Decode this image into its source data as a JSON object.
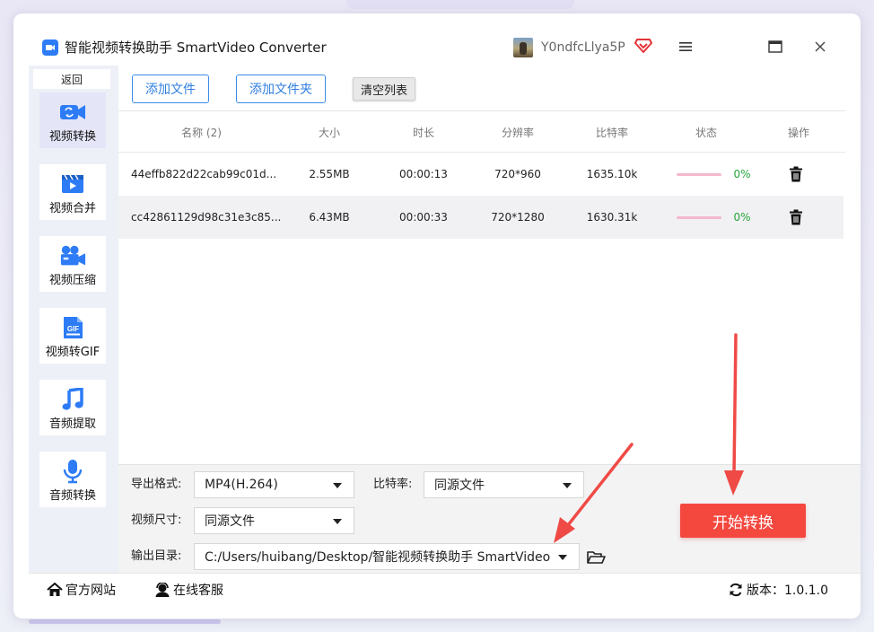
{
  "window": {
    "title": "智能视频转换助手 SmartVideo Converter",
    "username": "Y0ndfcLlya5P"
  },
  "sidebar": {
    "back_label": "返回",
    "items": [
      {
        "label": "视频转换",
        "icon": "video-convert-icon",
        "active": true
      },
      {
        "label": "视频合并",
        "icon": "video-merge-icon",
        "active": false
      },
      {
        "label": "视频压缩",
        "icon": "video-compress-icon",
        "active": false
      },
      {
        "label": "视频转GIF",
        "icon": "gif-icon",
        "active": false
      },
      {
        "label": "音频提取",
        "icon": "music-note-icon",
        "active": false
      },
      {
        "label": "音频转换",
        "icon": "microphone-icon",
        "active": false
      }
    ]
  },
  "toolbar": {
    "add_file": "添加文件",
    "add_folder": "添加文件夹",
    "clear_list": "清空列表"
  },
  "table": {
    "headers": {
      "name": "名称 (2)",
      "size": "大小",
      "duration": "时长",
      "resolution": "分辨率",
      "bitrate": "比特率",
      "status": "状态",
      "action": "操作"
    },
    "rows": [
      {
        "name": "44effb822d22cab99c01d...",
        "size": "2.55MB",
        "duration": "00:00:13",
        "resolution": "720*960",
        "bitrate": "1635.10k",
        "progress": "0%"
      },
      {
        "name": "cc42861129d98c31e3c85...",
        "size": "6.43MB",
        "duration": "00:00:33",
        "resolution": "720*1280",
        "bitrate": "1630.31k",
        "progress": "0%"
      }
    ]
  },
  "settings": {
    "format_label": "导出格式:",
    "format_value": "MP4(H.264)",
    "bitrate_label": "比特率:",
    "bitrate_value": "同源文件",
    "size_label": "视频尺寸:",
    "size_value": "同源文件",
    "output_label": "输出目录:",
    "output_value": "C:/Users/huibang/Desktop/智能视频转换助手 SmartVideo",
    "start_button": "开始转换"
  },
  "footer": {
    "website": "官方网站",
    "support": "在线客服",
    "version": "版本：1.0.1.0"
  },
  "colors": {
    "accent": "#2f7fe0",
    "start_button": "#f4483f",
    "arrow": "#f04a46",
    "progress_text": "#25a33a"
  }
}
